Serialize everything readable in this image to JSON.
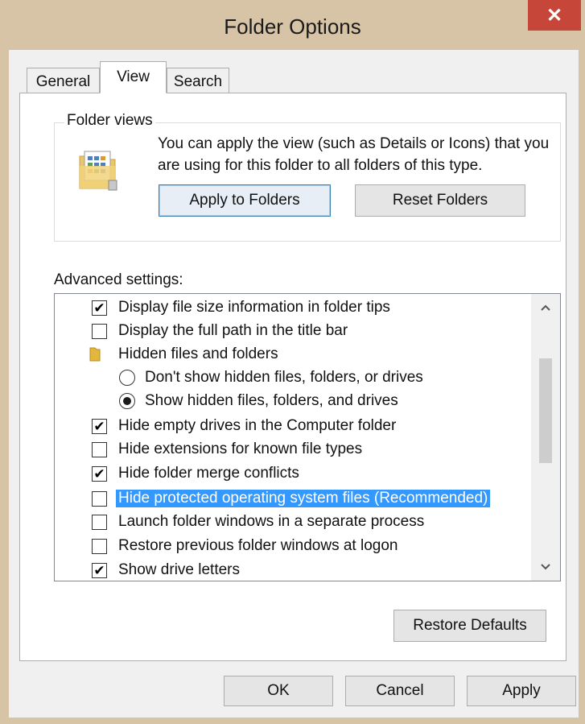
{
  "window": {
    "title": "Folder Options",
    "close_glyph": "✕"
  },
  "tabs": [
    {
      "label": "General"
    },
    {
      "label": "View"
    },
    {
      "label": "Search"
    }
  ],
  "folder_views": {
    "legend": "Folder views",
    "description": "You can apply the view (such as Details or Icons) that you are using for this folder to all folders of this type.",
    "apply_button": "Apply to Folders",
    "reset_button": "Reset Folders"
  },
  "advanced": {
    "label": "Advanced settings:",
    "items": [
      {
        "type": "checkbox",
        "checked": true,
        "label": "Display file size information in folder tips"
      },
      {
        "type": "checkbox",
        "checked": false,
        "label": "Display the full path in the title bar"
      },
      {
        "type": "folder",
        "label": "Hidden files and folders"
      },
      {
        "type": "radio",
        "checked": false,
        "label": "Don't show hidden files, folders, or drives"
      },
      {
        "type": "radio",
        "checked": true,
        "label": "Show hidden files, folders, and drives"
      },
      {
        "type": "checkbox",
        "checked": true,
        "label": "Hide empty drives in the Computer folder"
      },
      {
        "type": "checkbox",
        "checked": false,
        "label": "Hide extensions for known file types"
      },
      {
        "type": "checkbox",
        "checked": true,
        "label": "Hide folder merge conflicts"
      },
      {
        "type": "checkbox",
        "checked": false,
        "label": "Hide protected operating system files (Recommended)",
        "selected": true
      },
      {
        "type": "checkbox",
        "checked": false,
        "label": "Launch folder windows in a separate process"
      },
      {
        "type": "checkbox",
        "checked": false,
        "label": "Restore previous folder windows at logon"
      },
      {
        "type": "checkbox",
        "checked": true,
        "label": "Show drive letters"
      }
    ],
    "restore_defaults": "Restore Defaults"
  },
  "footer": {
    "ok": "OK",
    "cancel": "Cancel",
    "apply": "Apply"
  },
  "colors": {
    "selection": "#3399ff",
    "close": "#c7463a",
    "frame": "#d7c3a6"
  },
  "icons": {
    "check": "✔",
    "scroll_up": "chevron-up-icon",
    "scroll_down": "chevron-down-icon"
  }
}
